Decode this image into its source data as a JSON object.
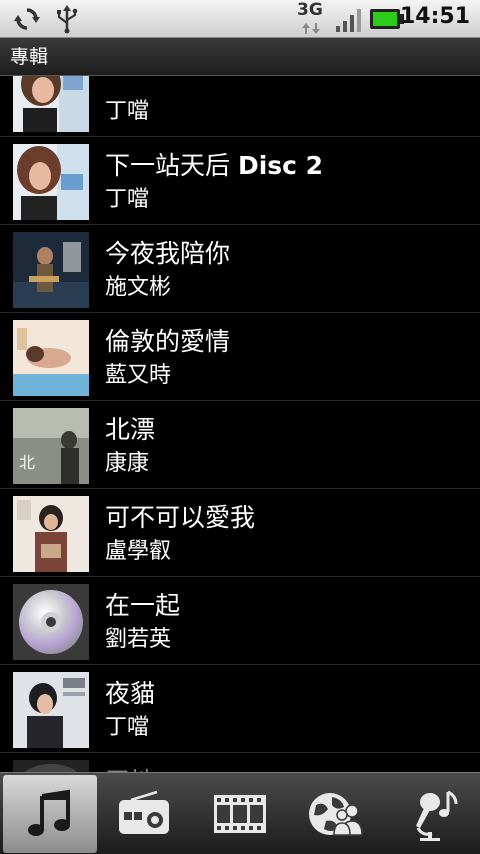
{
  "status_bar": {
    "time": "14:51",
    "network": "3G",
    "icons": [
      "sync-icon",
      "usb-icon",
      "network-3g-icon",
      "signal-icon",
      "battery-icon"
    ]
  },
  "header": {
    "title": "專輯"
  },
  "albums": [
    {
      "album": "",
      "artist": "丁噹"
    },
    {
      "album": "下一站天后 ",
      "album_bold": "Disc 2",
      "artist": "丁噹"
    },
    {
      "album": "今夜我陪你",
      "artist": "施文彬"
    },
    {
      "album": "倫敦的愛情",
      "artist": "藍又時"
    },
    {
      "album": "北漂",
      "artist": "康康"
    },
    {
      "album": "可不可以愛我",
      "artist": "盧學叡"
    },
    {
      "album": "在一起",
      "artist": "劉若英"
    },
    {
      "album": "夜貓",
      "artist": "丁噹"
    },
    {
      "album": "天地",
      "artist": ""
    }
  ],
  "tabs": [
    {
      "name": "music",
      "icon": "music-note-icon",
      "active": true
    },
    {
      "name": "radio",
      "icon": "radio-icon",
      "active": false
    },
    {
      "name": "video",
      "icon": "film-icon",
      "active": false
    },
    {
      "name": "community",
      "icon": "globe-people-icon",
      "active": false
    },
    {
      "name": "karaoke",
      "icon": "microphone-icon",
      "active": false
    }
  ],
  "colors": {
    "status_bar": "#dcdcdc",
    "battery": "#2ecc1a",
    "list_bg": "#000000",
    "active_tab": "#bdbdbd"
  }
}
